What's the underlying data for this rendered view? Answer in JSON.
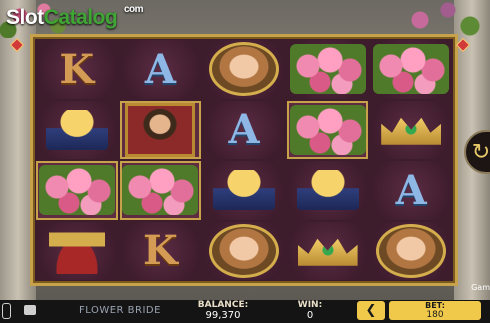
{
  "logo": {
    "part1": "Slot",
    "part2": "Catalog",
    "suffix": "com"
  },
  "game": {
    "title": "FLOWER BRIDE"
  },
  "status": {
    "balance_label": "BALANCE:",
    "balance_value": "99,370",
    "win_label": "WIN:",
    "win_value": "0",
    "bet_label": "BET:",
    "bet_value": "180",
    "side_text": "Gam"
  },
  "icons": {
    "sound": "speaker-icon",
    "games": "games-menu-icon",
    "bet_decrease": "chevron-left-icon",
    "spin": "spin-arrow-icon"
  },
  "reels": [
    [
      "K",
      "A",
      "portrait",
      "roses",
      "roses"
    ],
    [
      "gold",
      "king",
      "A",
      "roses",
      "crown"
    ],
    [
      "roses",
      "roses",
      "gold",
      "gold",
      "A"
    ],
    [
      "chalice",
      "K",
      "portrait",
      "crown",
      "portrait"
    ]
  ],
  "highlighted": [
    [
      1,
      1
    ],
    [
      1,
      3
    ],
    [
      2,
      0
    ],
    [
      2,
      1
    ]
  ],
  "glyphs": {
    "K": "K",
    "A": "A",
    "bet_decrease": "❮",
    "spin": "↻"
  },
  "colors": {
    "frame_gold": "#c7a24a",
    "reel_bg": "#3d1c2c",
    "button_yellow": "#f1c94a"
  }
}
